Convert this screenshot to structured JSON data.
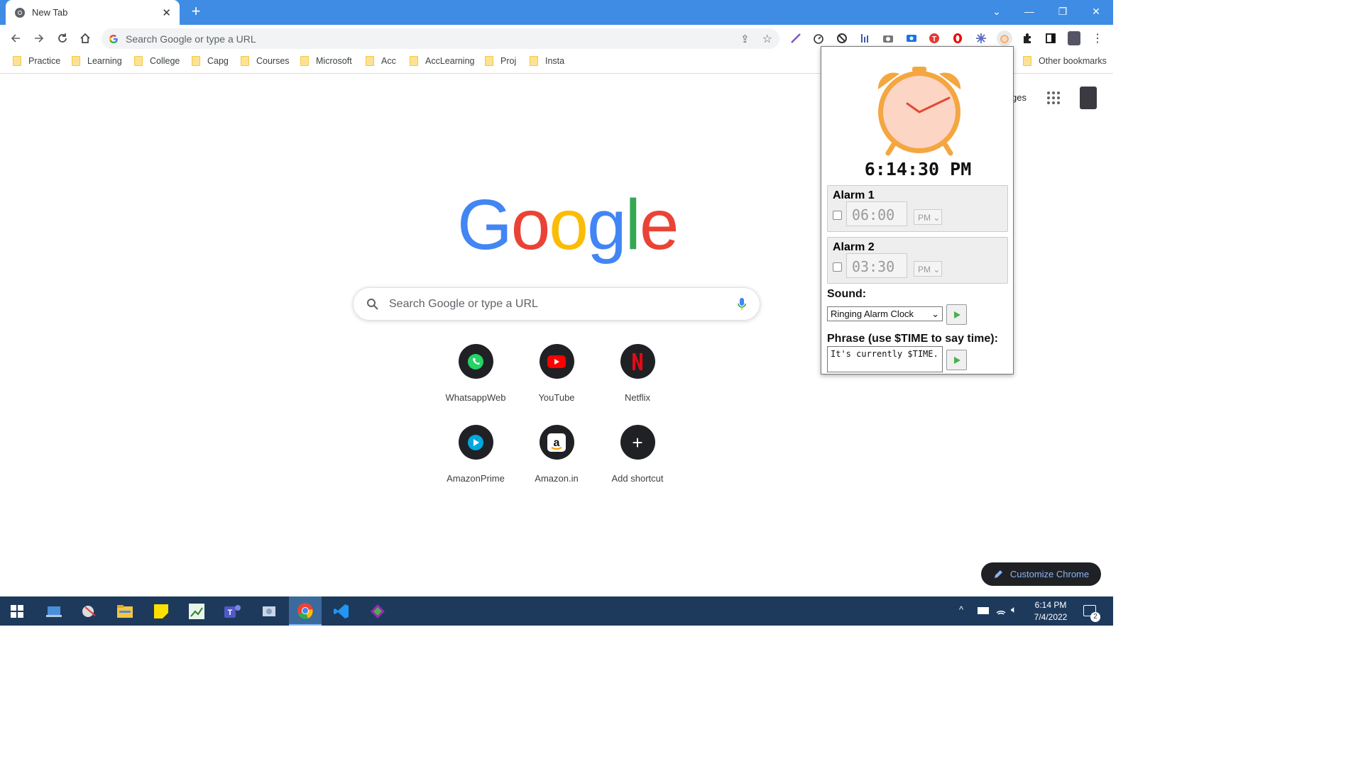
{
  "tab": {
    "title": "New Tab"
  },
  "omnibox": {
    "placeholder": "Search Google or type a URL"
  },
  "bookmarks": [
    "Practice",
    "Learning",
    "College",
    "Capg",
    "Courses",
    "Microsoft",
    "Acc",
    "AccLearning",
    "Proj",
    "Insta"
  ],
  "other_bookmarks": "Other bookmarks",
  "header_right": {
    "images_partial": "ges"
  },
  "search": {
    "placeholder": "Search Google or type a URL"
  },
  "logo_letters": [
    "G",
    "o",
    "o",
    "g",
    "l",
    "e"
  ],
  "logo_colors": [
    "#4285f4",
    "#ea4335",
    "#fbbc05",
    "#4285f4",
    "#34a853",
    "#ea4335"
  ],
  "shortcuts": [
    {
      "label": "WhatsappWeb",
      "icon": "whatsapp-icon"
    },
    {
      "label": "YouTube",
      "icon": "youtube-icon"
    },
    {
      "label": "Netflix",
      "icon": "netflix-icon"
    },
    {
      "label": "AmazonPrime",
      "icon": "prime-video-icon"
    },
    {
      "label": "Amazon.in",
      "icon": "amazon-icon"
    },
    {
      "label": "Add shortcut",
      "icon": "plus-icon"
    }
  ],
  "customize": {
    "label": "Customize Chrome"
  },
  "popup": {
    "time": "6:14:30 PM",
    "alarms": [
      {
        "title": "Alarm 1",
        "time": "06:00",
        "ampm": "PM",
        "enabled": false
      },
      {
        "title": "Alarm 2",
        "time": "03:30",
        "ampm": "PM",
        "enabled": false
      }
    ],
    "sound_label": "Sound:",
    "sound_value": "Ringing Alarm Clock",
    "phrase_label": "Phrase (use $TIME to say time):",
    "phrase_value": "It's currently $TIME."
  },
  "taskbar": {
    "time": "6:14 PM",
    "date": "7/4/2022",
    "notification_count": "2"
  }
}
